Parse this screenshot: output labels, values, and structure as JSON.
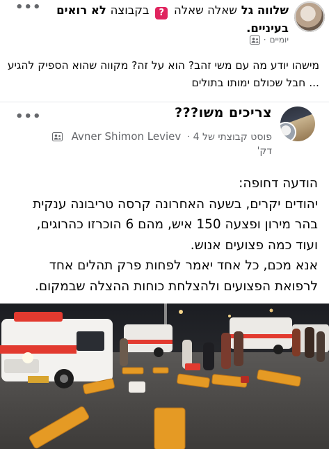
{
  "outer_post": {
    "author": "שלווה גל",
    "action": "שאלה שאלה",
    "question_emoji": "?",
    "in_group": "בקבוצה",
    "group_name": "לא רואים בעיניים.",
    "time": "יומיים",
    "separator": "·",
    "audience_icon": "people-icon",
    "more_icon": "more-dots-icon",
    "text": "מישהו יודע מה עם משי זהב? הוא על זה? מקווה שהוא הספיק להגיע ... חבל שכולם ימותו בתולים"
  },
  "shared_post": {
    "title": "צריכים משו???",
    "meta_prefix": "פוסט קבוצתי של",
    "author": "Avner Shimon Leviev",
    "meta_suffix": "4",
    "time": "דק'",
    "separator": "·",
    "audience_icon": "people-icon",
    "more_icon": "more-dots-icon",
    "body_lines": [
      "הודעה דחופה:",
      "יהודים יקרים, בשעה האחרונה קרסה טריבונה ענקית",
      "בהר מירון ופצעה 150 איש, מהם 6 הוכרזו כהרוגים,",
      "ועוד כמה פצועים אנוש.",
      "אנא מכם, כל אחד יאמר לפחות פרק תהלים אחד",
      "לרפואת הפצועים ולהצלחת כוחות ההצלה שבמקום."
    ],
    "photo": "ambulance-rescue-scene-photo"
  }
}
